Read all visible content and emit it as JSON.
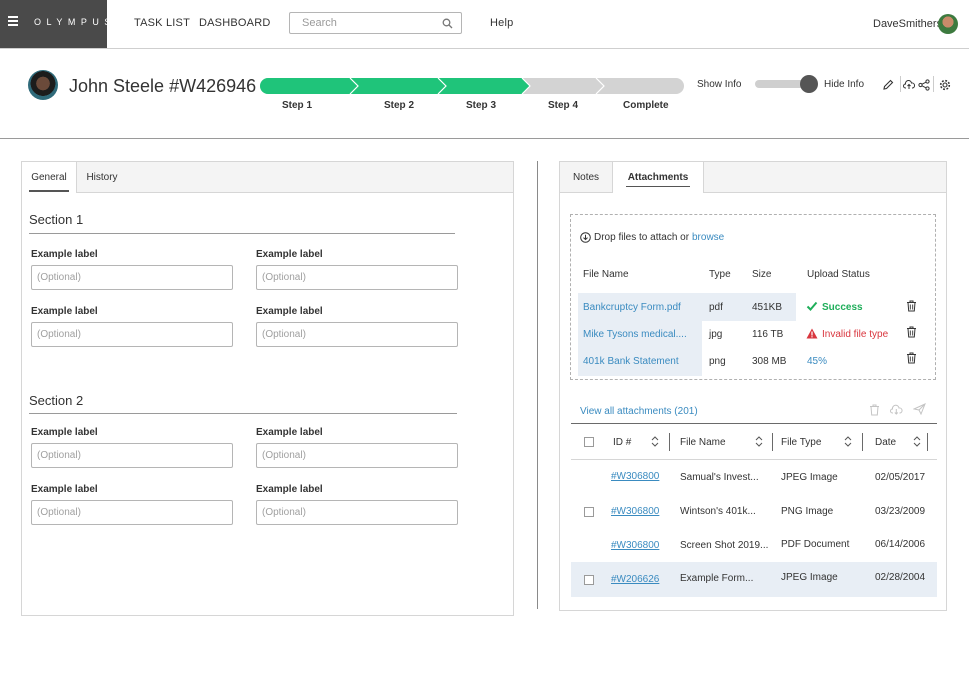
{
  "app": {
    "brand": "OLYMPUS",
    "nav": {
      "task_list": "TASK LIST",
      "dashboard": "DASHBOARD",
      "help": "Help"
    },
    "search": {
      "placeholder": "Search"
    },
    "user": {
      "name": "DaveSmithers"
    }
  },
  "record": {
    "title": "John Steele #W426946",
    "steps": [
      {
        "label": "Step 1",
        "complete": true
      },
      {
        "label": "Step 2",
        "complete": true
      },
      {
        "label": "Step 3",
        "complete": true
      },
      {
        "label": "Step 4",
        "complete": false
      },
      {
        "label": "Complete",
        "complete": false
      }
    ],
    "show_info": "Show Info",
    "hide_info": "Hide Info",
    "actions": [
      "edit-icon",
      "cloud-upload-icon",
      "share-icon",
      "gear-icon"
    ],
    "colors": {
      "progress": "#1fc47a",
      "progress_pending": "#d3d3d3"
    }
  },
  "left": {
    "tabs": {
      "general": "General",
      "history": "History"
    },
    "sections": [
      {
        "title": "Section 1",
        "fields": [
          {
            "label": "Example label",
            "placeholder": "(Optional)"
          },
          {
            "label": "Example label",
            "placeholder": "(Optional)"
          },
          {
            "label": "Example label",
            "placeholder": "(Optional)"
          },
          {
            "label": "Example label",
            "placeholder": "(Optional)"
          }
        ]
      },
      {
        "title": "Section 2",
        "fields": [
          {
            "label": "Example label",
            "placeholder": "(Optional)"
          },
          {
            "label": "Example label",
            "placeholder": "(Optional)"
          },
          {
            "label": "Example label",
            "placeholder": "(Optional)"
          },
          {
            "label": "Example label",
            "placeholder": "(Optional)"
          }
        ]
      }
    ]
  },
  "right": {
    "tabs": {
      "notes": "Notes",
      "attachments": "Attachments"
    },
    "drop_text": "Drop files to attach or",
    "browse": "browse",
    "upload_headers": {
      "file_name": "File Name",
      "type": "Type",
      "size": "Size",
      "status": "Upload Status"
    },
    "uploads": [
      {
        "name": "Bankcruptcy Form.pdf",
        "type": "pdf",
        "size": "451KB",
        "status": "Success",
        "status_kind": "success"
      },
      {
        "name": "Mike Tysons medical....",
        "type": "jpg",
        "size": "116 TB",
        "status": "Invalid file type",
        "status_kind": "error"
      },
      {
        "name": "401k Bank Statement",
        "type": "png",
        "size": "308 MB",
        "status": "45%",
        "status_kind": "progress"
      }
    ],
    "view_all": "View all attachments (201)",
    "table_headers": {
      "id": "ID #",
      "file_name": "File Name",
      "file_type": "File Type",
      "date": "Date"
    },
    "rows": [
      {
        "id": "#W306800",
        "file": "Samual's Invest...",
        "type": "JPEG Image",
        "date": "02/05/2017",
        "checkbox": false,
        "highlight": false
      },
      {
        "id": "#W306800",
        "file": "Wintson's 401k...",
        "type": "PNG Image",
        "date": "03/23/2009",
        "checkbox": true,
        "highlight": false
      },
      {
        "id": "#W306800",
        "file": "Screen Shot 2019...",
        "type": "PDF Document",
        "date": "06/14/2006",
        "checkbox": false,
        "highlight": false
      },
      {
        "id": "#W206626",
        "file": "Example Form...",
        "type": "JPEG Image",
        "date": "02/28/2004",
        "checkbox": true,
        "highlight": true
      }
    ],
    "colors": {
      "link": "#3a8bc0",
      "success": "#1fae5a",
      "error": "#d9363e"
    }
  }
}
